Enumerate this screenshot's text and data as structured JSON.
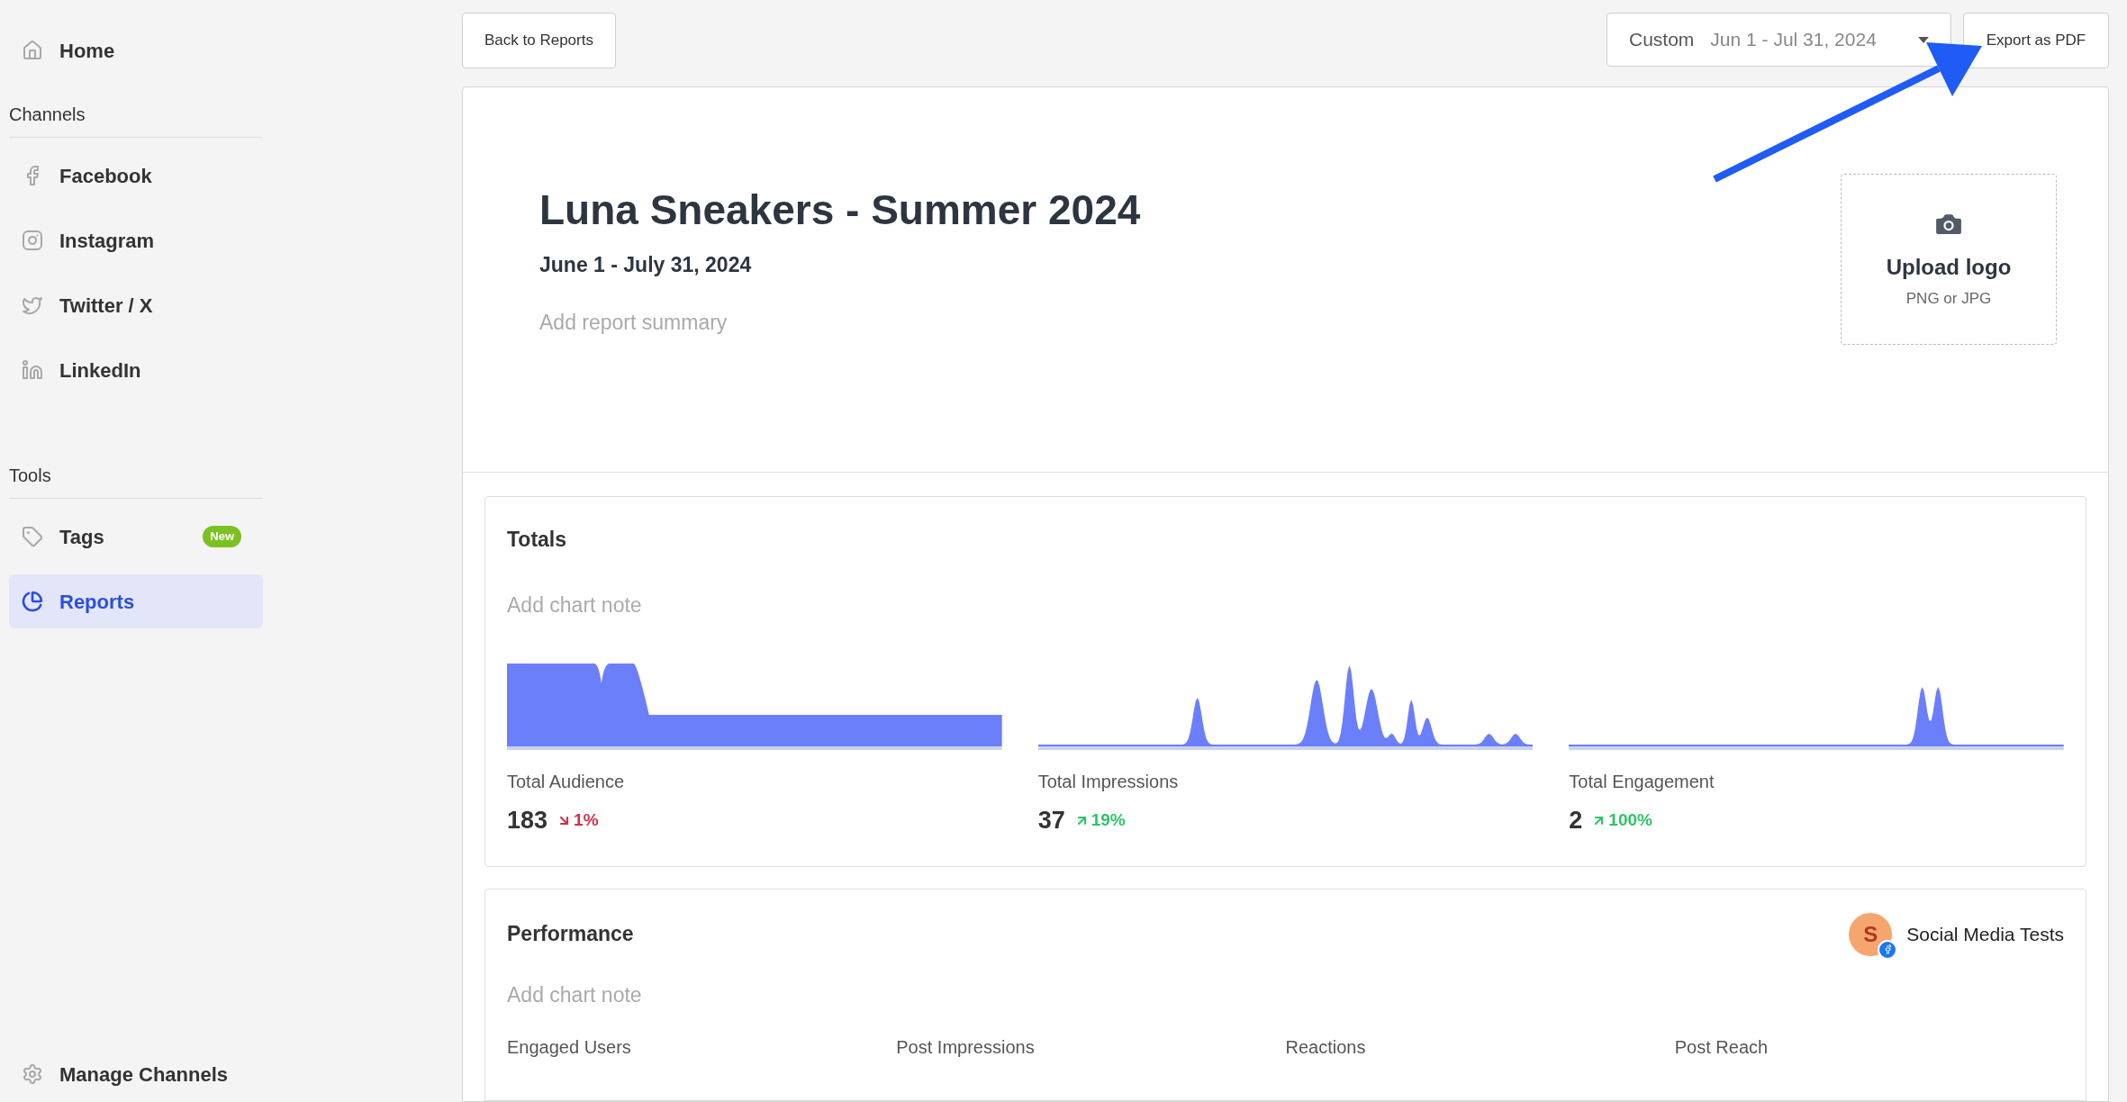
{
  "sidebar": {
    "home": {
      "label": "Home",
      "selected": false
    },
    "sections": [
      {
        "title": "Channels",
        "items": [
          {
            "label": "Facebook",
            "selected": false
          },
          {
            "label": "Instagram",
            "selected": false
          },
          {
            "label": "Twitter / X",
            "selected": false
          },
          {
            "label": "LinkedIn",
            "selected": false
          }
        ]
      },
      {
        "title": "Tools",
        "items": [
          {
            "label": "Tags",
            "selected": false,
            "badge": "New"
          },
          {
            "label": "Reports",
            "selected": true
          }
        ]
      }
    ],
    "footer": {
      "label": "Manage Channels"
    }
  },
  "toolbar": {
    "back_button": "Back to Reports",
    "date_range": {
      "preset": "Custom",
      "value": "Jun 1 - Jul 31, 2024"
    },
    "export_button": "Export as PDF"
  },
  "report": {
    "title": "Luna Sneakers - Summer 2024",
    "date": "June 1 - July 31, 2024",
    "summary_placeholder": "Add report summary",
    "logo": {
      "title": "Upload logo",
      "hint": "PNG or JPG"
    }
  },
  "totals": {
    "title": "Totals",
    "note_placeholder": "Add chart note",
    "metrics": [
      {
        "label": "Total Audience",
        "value": "183",
        "change": "1%",
        "kind": "decrease"
      },
      {
        "label": "Total Impressions",
        "value": "37",
        "change": "19%",
        "kind": "increase"
      },
      {
        "label": "Total Engagement",
        "value": "2",
        "change": "100%",
        "kind": "increase"
      }
    ]
  },
  "performance": {
    "title": "Performance",
    "account": {
      "initial": "S",
      "name": "Social Media Tests"
    },
    "note_placeholder": "Add chart note",
    "columns": [
      "Engaged Users",
      "Post Impressions",
      "Reactions",
      "Post Reach"
    ]
  }
}
